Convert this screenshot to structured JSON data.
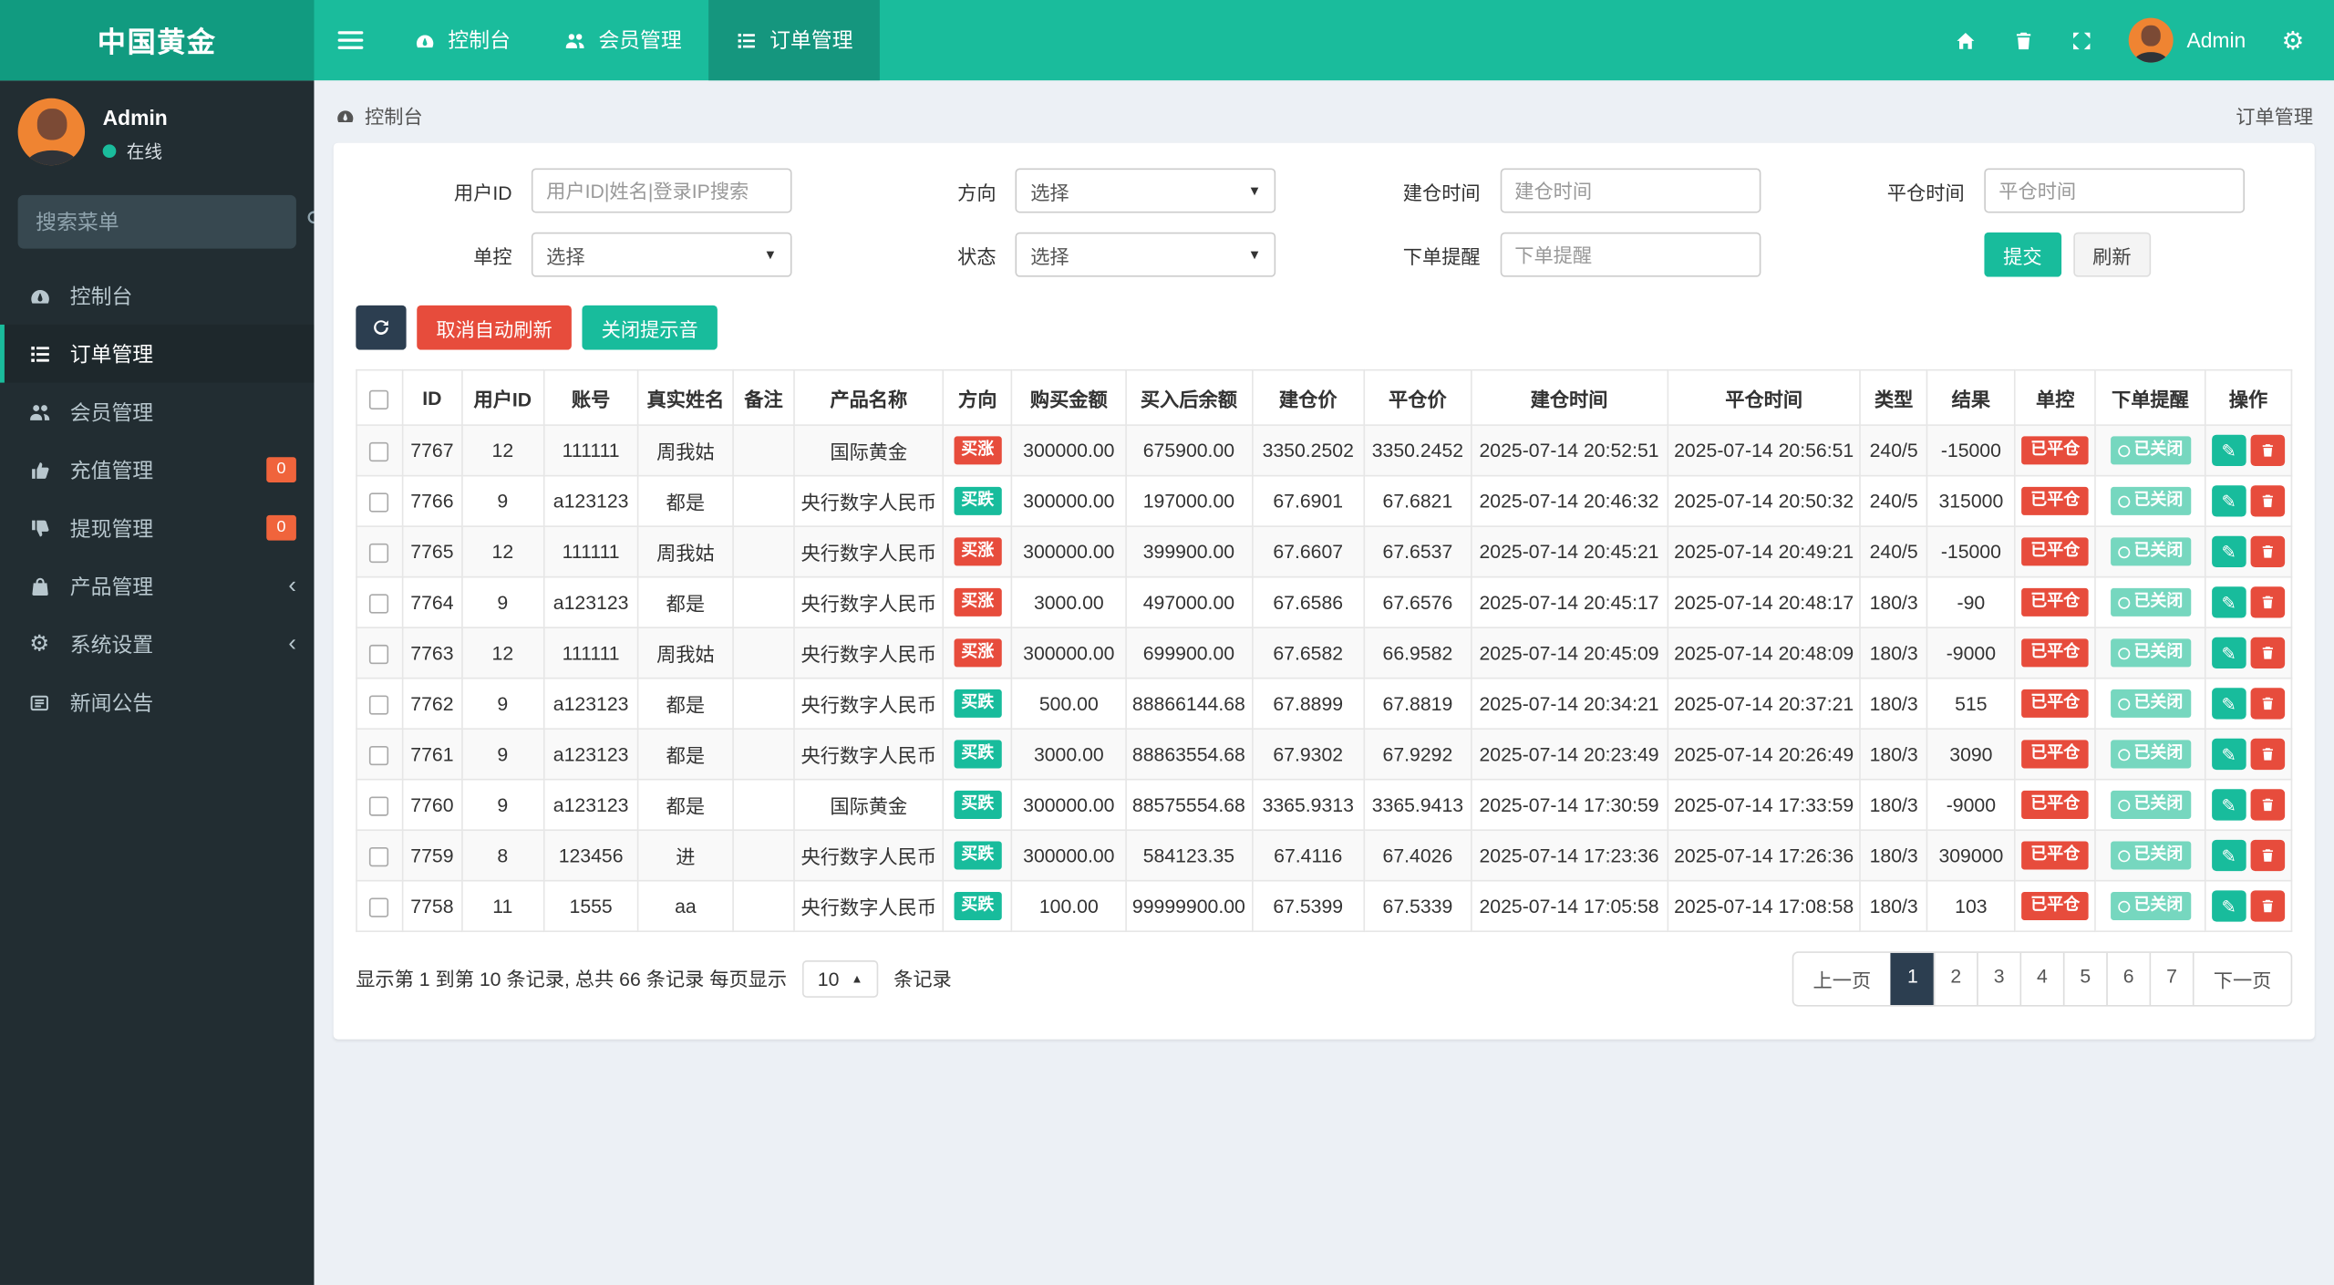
{
  "colors": {
    "accent": "#1abc9c",
    "brand-bg": "#119b80",
    "nav-active": "#15967e",
    "sidebar-bg": "#222d32",
    "sidebar-active": "#1e282c",
    "danger": "#e74c3c",
    "btn-teal": "#18bc9c",
    "btn-dark": "#2c3e50",
    "badge-orange": "#f0643c",
    "remind": "#76d7bf"
  },
  "navbar": {
    "brand": "中国黄金",
    "tabs": [
      {
        "key": "dashboard",
        "icon": "gauge",
        "label": "控制台",
        "active": false
      },
      {
        "key": "members",
        "icon": "users",
        "label": "会员管理",
        "active": false
      },
      {
        "key": "orders",
        "icon": "list-ol",
        "label": "订单管理",
        "active": true
      }
    ],
    "user_name": "Admin"
  },
  "sidebar": {
    "user": {
      "name": "Admin",
      "status": "在线"
    },
    "search_placeholder": "搜索菜单",
    "items": [
      {
        "key": "dashboard",
        "icon": "gauge",
        "label": "控制台",
        "active": false
      },
      {
        "key": "orders",
        "icon": "list-ol",
        "label": "订单管理",
        "active": true
      },
      {
        "key": "members",
        "icon": "users",
        "label": "会员管理",
        "active": false
      },
      {
        "key": "recharge",
        "icon": "thumbs-up",
        "label": "充值管理",
        "badge": "0"
      },
      {
        "key": "withdraw",
        "icon": "thumbs-down",
        "label": "提现管理",
        "badge": "0"
      },
      {
        "key": "products",
        "icon": "bag",
        "label": "产品管理",
        "chevron": true
      },
      {
        "key": "settings",
        "icon": "gears",
        "label": "系统设置",
        "chevron": true
      },
      {
        "key": "news",
        "icon": "newspaper",
        "label": "新闻公告"
      }
    ]
  },
  "breadcrumb": {
    "left": "控制台",
    "right": "订单管理"
  },
  "filters": {
    "user_id_label": "用户ID",
    "user_id_placeholder": "用户ID|姓名|登录IP搜索",
    "direction_label": "方向",
    "direction_value": "选择",
    "open_time_label": "建仓时间",
    "open_time_placeholder": "建仓时间",
    "close_time_label": "平仓时间",
    "close_time_placeholder": "平仓时间",
    "control_label": "单控",
    "control_value": "选择",
    "status_label": "状态",
    "status_value": "选择",
    "remind_label": "下单提醒",
    "remind_placeholder": "下单提醒",
    "submit_label": "提交",
    "refresh_label": "刷新"
  },
  "toolbar": {
    "cancel_auto_refresh": "取消自动刷新",
    "close_sound": "关闭提示音"
  },
  "table": {
    "headers": [
      "ID",
      "用户ID",
      "账号",
      "真实姓名",
      "备注",
      "产品名称",
      "方向",
      "购买金额",
      "买入后余额",
      "建仓价",
      "平仓价",
      "建仓时间",
      "平仓时间",
      "类型",
      "结果",
      "单控",
      "下单提醒",
      "操作"
    ],
    "direction_up": "买涨",
    "direction_down": "买跌",
    "control_badge": "已平仓",
    "remind_badge": "已关闭",
    "rows": [
      {
        "id": "7767",
        "user_id": "12",
        "account": "111111",
        "real_name": "周我姑",
        "remark": "",
        "product": "国际黄金",
        "direction": "up",
        "amount": "300000.00",
        "balance_after": "675900.00",
        "open_price": "3350.2502",
        "close_price": "3350.2452",
        "open_time": "2025-07-14 20:52:51",
        "close_time": "2025-07-14 20:56:51",
        "type": "240/5",
        "result": "-15000"
      },
      {
        "id": "7766",
        "user_id": "9",
        "account": "a123123",
        "real_name": "都是",
        "remark": "",
        "product": "央行数字人民币",
        "direction": "down",
        "amount": "300000.00",
        "balance_after": "197000.00",
        "open_price": "67.6901",
        "close_price": "67.6821",
        "open_time": "2025-07-14 20:46:32",
        "close_time": "2025-07-14 20:50:32",
        "type": "240/5",
        "result": "315000"
      },
      {
        "id": "7765",
        "user_id": "12",
        "account": "111111",
        "real_name": "周我姑",
        "remark": "",
        "product": "央行数字人民币",
        "direction": "up",
        "amount": "300000.00",
        "balance_after": "399900.00",
        "open_price": "67.6607",
        "close_price": "67.6537",
        "open_time": "2025-07-14 20:45:21",
        "close_time": "2025-07-14 20:49:21",
        "type": "240/5",
        "result": "-15000"
      },
      {
        "id": "7764",
        "user_id": "9",
        "account": "a123123",
        "real_name": "都是",
        "remark": "",
        "product": "央行数字人民币",
        "direction": "up",
        "amount": "3000.00",
        "balance_after": "497000.00",
        "open_price": "67.6586",
        "close_price": "67.6576",
        "open_time": "2025-07-14 20:45:17",
        "close_time": "2025-07-14 20:48:17",
        "type": "180/3",
        "result": "-90"
      },
      {
        "id": "7763",
        "user_id": "12",
        "account": "111111",
        "real_name": "周我姑",
        "remark": "",
        "product": "央行数字人民币",
        "direction": "up",
        "amount": "300000.00",
        "balance_after": "699900.00",
        "open_price": "67.6582",
        "close_price": "66.9582",
        "open_time": "2025-07-14 20:45:09",
        "close_time": "2025-07-14 20:48:09",
        "type": "180/3",
        "result": "-9000"
      },
      {
        "id": "7762",
        "user_id": "9",
        "account": "a123123",
        "real_name": "都是",
        "remark": "",
        "product": "央行数字人民币",
        "direction": "down",
        "amount": "500.00",
        "balance_after": "88866144.68",
        "open_price": "67.8899",
        "close_price": "67.8819",
        "open_time": "2025-07-14 20:34:21",
        "close_time": "2025-07-14 20:37:21",
        "type": "180/3",
        "result": "515"
      },
      {
        "id": "7761",
        "user_id": "9",
        "account": "a123123",
        "real_name": "都是",
        "remark": "",
        "product": "央行数字人民币",
        "direction": "down",
        "amount": "3000.00",
        "balance_after": "88863554.68",
        "open_price": "67.9302",
        "close_price": "67.9292",
        "open_time": "2025-07-14 20:23:49",
        "close_time": "2025-07-14 20:26:49",
        "type": "180/3",
        "result": "3090"
      },
      {
        "id": "7760",
        "user_id": "9",
        "account": "a123123",
        "real_name": "都是",
        "remark": "",
        "product": "国际黄金",
        "direction": "down",
        "amount": "300000.00",
        "balance_after": "88575554.68",
        "open_price": "3365.9313",
        "close_price": "3365.9413",
        "open_time": "2025-07-14 17:30:59",
        "close_time": "2025-07-14 17:33:59",
        "type": "180/3",
        "result": "-9000"
      },
      {
        "id": "7759",
        "user_id": "8",
        "account": "123456",
        "real_name": "进",
        "remark": "",
        "product": "央行数字人民币",
        "direction": "down",
        "amount": "300000.00",
        "balance_after": "584123.35",
        "open_price": "67.4116",
        "close_price": "67.4026",
        "open_time": "2025-07-14 17:23:36",
        "close_time": "2025-07-14 17:26:36",
        "type": "180/3",
        "result": "309000"
      },
      {
        "id": "7758",
        "user_id": "11",
        "account": "1555",
        "real_name": "aa",
        "remark": "",
        "product": "央行数字人民币",
        "direction": "down",
        "amount": "100.00",
        "balance_after": "99999900.00",
        "open_price": "67.5399",
        "close_price": "67.5339",
        "open_time": "2025-07-14 17:05:58",
        "close_time": "2025-07-14 17:08:58",
        "type": "180/3",
        "result": "103"
      }
    ]
  },
  "pagination": {
    "summary_prefix": "显示第 1 到第 10 条记录, 总共 66 条记录 每页显示",
    "page_size": "10",
    "summary_suffix": "条记录",
    "prev": "上一页",
    "pages": [
      "1",
      "2",
      "3",
      "4",
      "5",
      "6",
      "7"
    ],
    "active_page": "1",
    "next": "下一页"
  }
}
